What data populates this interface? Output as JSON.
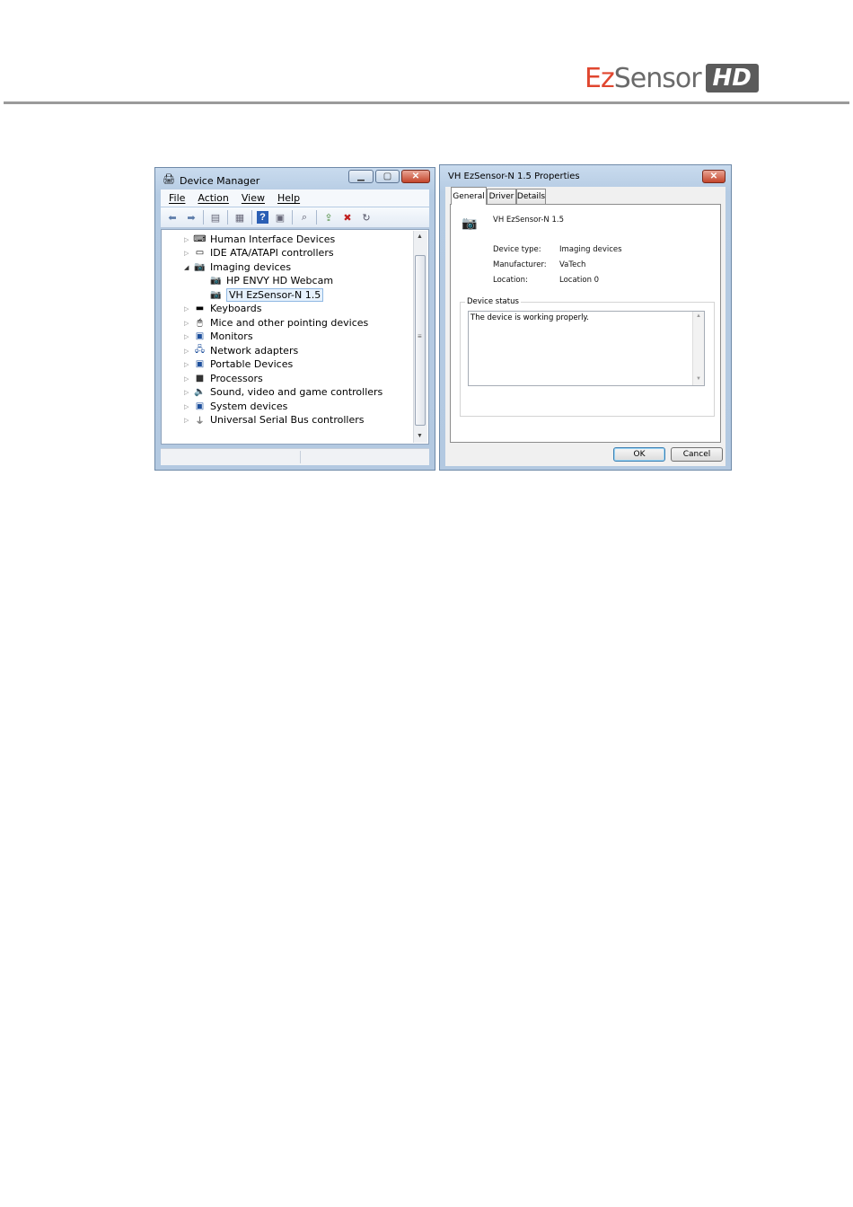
{
  "header": {
    "logo_ez": "Ez",
    "logo_sensor": "Sensor",
    "logo_hd": "HD"
  },
  "device_manager": {
    "title": "Device Manager",
    "menu": [
      "File",
      "Action",
      "View",
      "Help"
    ],
    "tree": [
      {
        "label": "Human Interface Devices",
        "icon": "hid-icon",
        "level": 0,
        "expanded": false
      },
      {
        "label": "IDE ATA/ATAPI controllers",
        "icon": "ide-controller-icon",
        "level": 0,
        "expanded": false
      },
      {
        "label": "Imaging devices",
        "icon": "camera-icon",
        "level": 0,
        "expanded": true
      },
      {
        "label": "HP ENVY HD Webcam",
        "icon": "camera-icon",
        "level": 1
      },
      {
        "label": "VH EzSensor-N 1.5",
        "icon": "camera-icon",
        "level": 1,
        "selected": true
      },
      {
        "label": "Keyboards",
        "icon": "keyboard-icon",
        "level": 0,
        "expanded": false
      },
      {
        "label": "Mice and other pointing devices",
        "icon": "mouse-icon",
        "level": 0,
        "expanded": false
      },
      {
        "label": "Monitors",
        "icon": "monitor-icon",
        "level": 0,
        "expanded": false
      },
      {
        "label": "Network adapters",
        "icon": "network-icon",
        "level": 0,
        "expanded": false
      },
      {
        "label": "Portable Devices",
        "icon": "portable-device-icon",
        "level": 0,
        "expanded": false
      },
      {
        "label": "Processors",
        "icon": "processor-icon",
        "level": 0,
        "expanded": false
      },
      {
        "label": "Sound, video and game controllers",
        "icon": "speaker-icon",
        "level": 0,
        "expanded": false
      },
      {
        "label": "System devices",
        "icon": "system-icon",
        "level": 0,
        "expanded": false
      },
      {
        "label": "Universal Serial Bus controllers",
        "icon": "usb-icon",
        "level": 0,
        "expanded": false
      }
    ]
  },
  "properties": {
    "title": "VH EzSensor-N 1.5 Properties",
    "tabs": [
      "General",
      "Driver",
      "Details"
    ],
    "device_name": "VH EzSensor-N 1.5",
    "fields": [
      {
        "label": "Device type:",
        "value": "Imaging devices"
      },
      {
        "label": "Manufacturer:",
        "value": "VaTech"
      },
      {
        "label": "Location:",
        "value": "Location 0"
      }
    ],
    "status_group_label": "Device status",
    "status_text": "The device is working properly.",
    "ok_label": "OK",
    "cancel_label": "Cancel"
  },
  "colors": {
    "brand_red": "#e0462f",
    "brand_gray": "#5b5b5b"
  }
}
